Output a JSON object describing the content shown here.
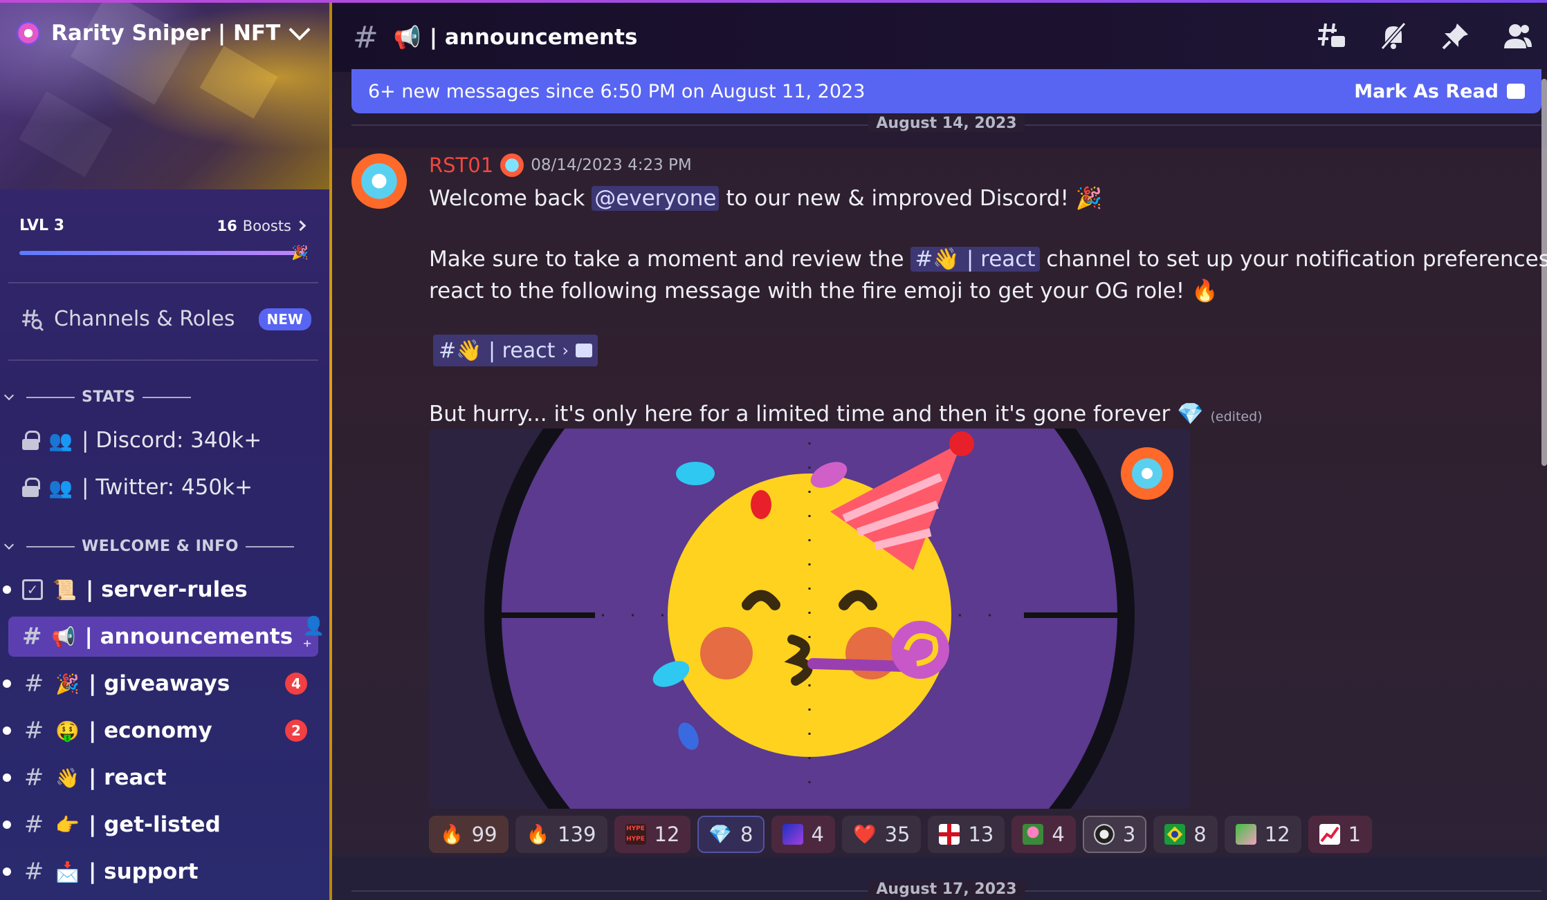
{
  "server": {
    "name": "Rarity Sniper | NFT",
    "level": "LVL 3",
    "boost_count": "16",
    "boost_word": "Boosts"
  },
  "sidebar": {
    "channels_roles": {
      "label": "Channels & Roles",
      "badge": "NEW"
    },
    "categories": [
      {
        "name": "STATS"
      },
      {
        "name": "WELCOME & INFO"
      }
    ],
    "stats_channels": [
      {
        "emoji": "👥",
        "label": "| Discord: 340k+"
      },
      {
        "emoji": "👥",
        "label": "| Twitter: 450k+"
      }
    ],
    "channels": [
      {
        "emoji": "📜",
        "label": "| server-rules",
        "badge": ""
      },
      {
        "emoji": "📢",
        "label": "| announcements",
        "badge": ""
      },
      {
        "emoji": "🎉",
        "label": "| giveaways",
        "badge": "4"
      },
      {
        "emoji": "🤑",
        "label": "| economy",
        "badge": "2"
      },
      {
        "emoji": "👋",
        "label": "| react",
        "badge": ""
      },
      {
        "emoji": "👉",
        "label": "| get-listed",
        "badge": ""
      },
      {
        "emoji": "📩",
        "label": "| support",
        "badge": ""
      }
    ]
  },
  "header": {
    "channel_emoji": "📢",
    "channel_name": "| announcements"
  },
  "new_messages_bar": {
    "text": "6+ new messages since 6:50 PM on August 11, 2023",
    "action": "Mark As Read"
  },
  "date_separators": [
    "August 14, 2023",
    "August 17, 2023"
  ],
  "message": {
    "author": "RST01",
    "timestamp": "08/14/2023 4:23 PM",
    "line1_pre": "Welcome back ",
    "mention": "@everyone",
    "line1_post": " to our new & improved Discord! 🎉",
    "line2_pre": "Make sure to take a moment and review the ",
    "channel_ref": "#👋 | react",
    "line2_post": "  channel to set up your notification preferences and",
    "line3": "react to the following message with the fire emoji to get your OG role! 🔥",
    "thread_ref": "#👋 | react",
    "line4": "But hurry... it's only here for a limited time and then it's gone forever 💎",
    "edited": "(edited)"
  },
  "reactions": [
    {
      "emoji": "🔥",
      "count": "99"
    },
    {
      "emoji": "🔥",
      "count": "139"
    },
    {
      "emoji": "hype-emote",
      "count": "12"
    },
    {
      "emoji": "💎",
      "count": "8"
    },
    {
      "emoji": "wizard-emote",
      "count": "4"
    },
    {
      "emoji": "❤️",
      "count": "35"
    },
    {
      "emoji": "england-flag",
      "count": "13"
    },
    {
      "emoji": "frog-heart-emote",
      "count": "4"
    },
    {
      "emoji": "coin-emote",
      "count": "3"
    },
    {
      "emoji": "🇧🇷",
      "count": "8"
    },
    {
      "emoji": "frog-emote",
      "count": "12"
    },
    {
      "emoji": "chart-emote",
      "count": "1"
    }
  ],
  "colors": {
    "accent": "#5865f2",
    "author": "#f0473e",
    "active_channel": "#5b3fb0",
    "badge": "#f23f43"
  }
}
